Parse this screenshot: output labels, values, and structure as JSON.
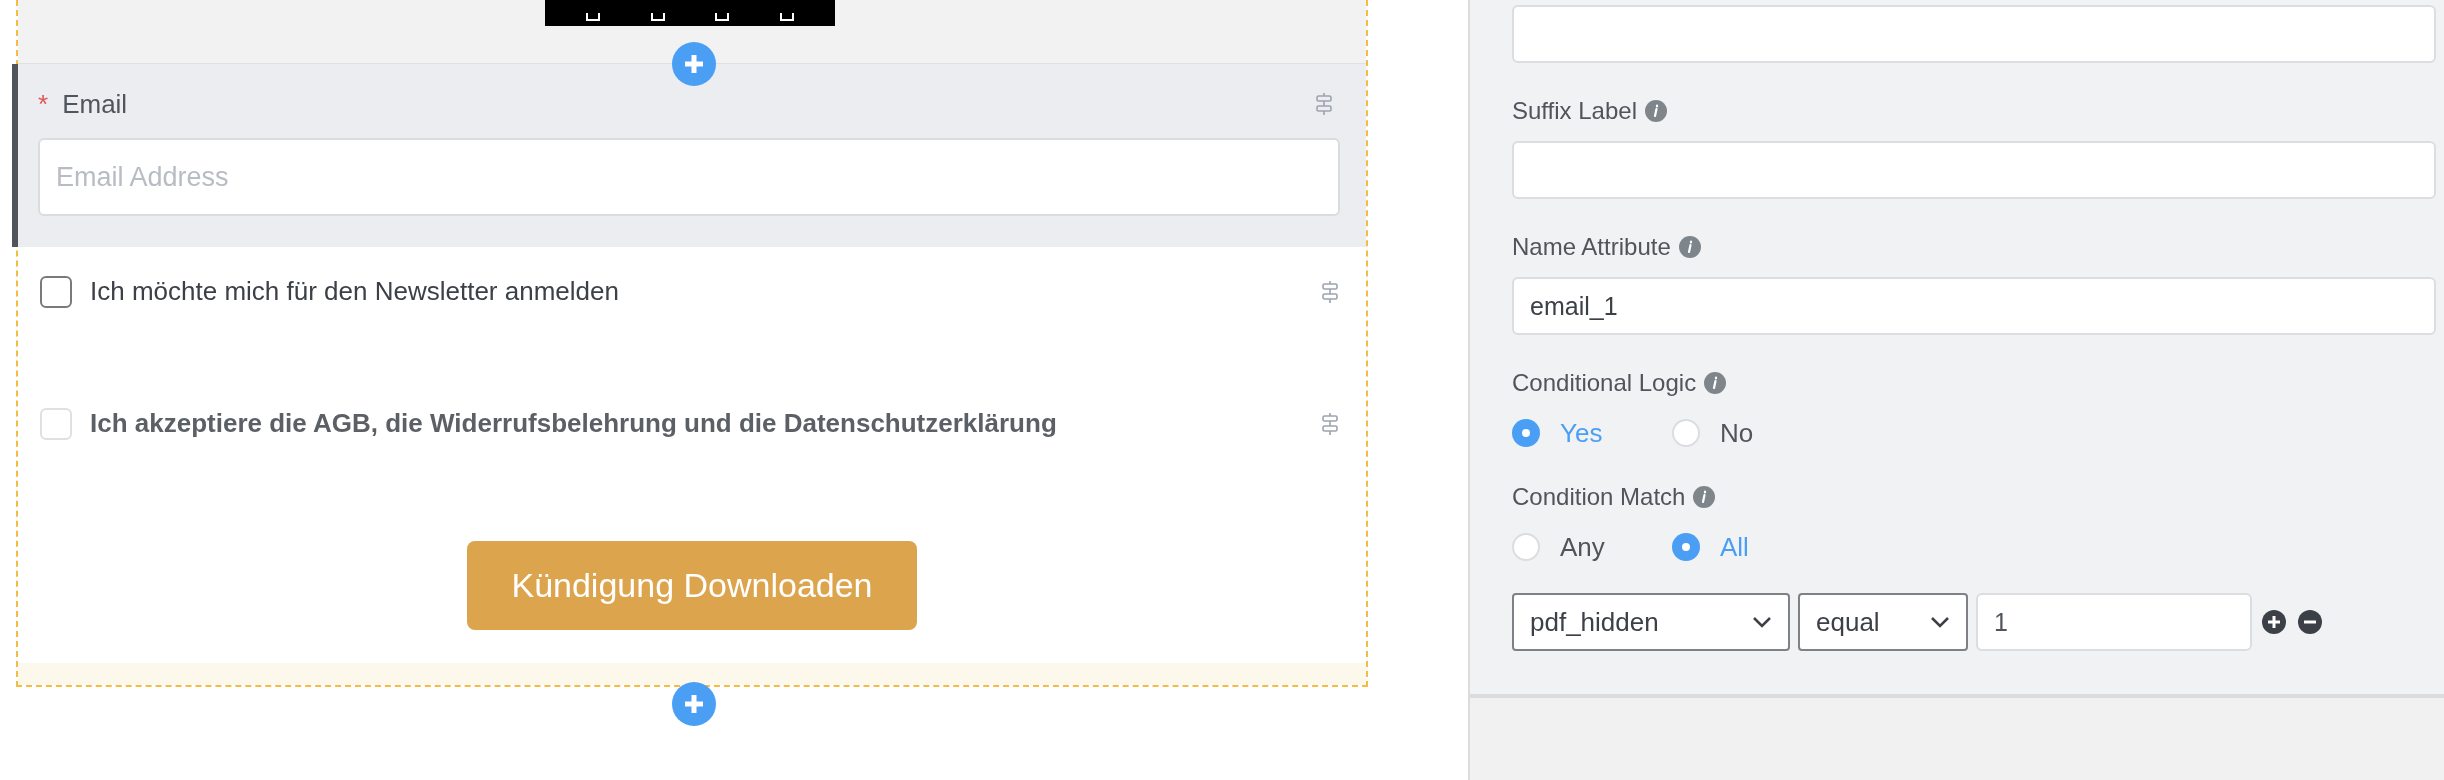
{
  "form": {
    "email_field": {
      "required_mark": "*",
      "label": "Email",
      "placeholder": "Email Address"
    },
    "checkboxes": [
      {
        "label": "Ich möchte mich für den Newsletter anmelden",
        "checked": false,
        "muted": false
      },
      {
        "label": "Ich akzeptiere die AGB, die Widerrufsbelehrung und die Datenschutzerklärung",
        "checked": false,
        "muted": true
      }
    ],
    "submit_button": "Kündigung Downloaden"
  },
  "settings": {
    "fields": [
      {
        "label": "Suffix Label"
      },
      {
        "label": "Name Attribute",
        "value": "email_1"
      }
    ],
    "radio_groups": [
      {
        "label": "Conditional Logic",
        "options": [
          {
            "label": "Yes",
            "selected": true
          },
          {
            "label": "No",
            "selected": false
          }
        ]
      },
      {
        "label": "Condition Match",
        "options": [
          {
            "label": "Any",
            "selected": false
          },
          {
            "label": "All",
            "selected": true
          }
        ]
      }
    ],
    "condition": {
      "field": "pdf_hidden",
      "operator": "equal",
      "value": "1"
    }
  }
}
